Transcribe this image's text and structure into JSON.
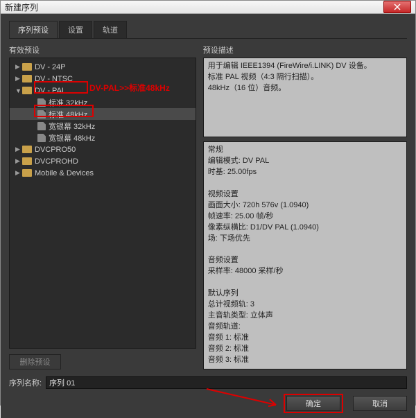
{
  "window": {
    "title": "新建序列"
  },
  "tabs": {
    "t0": "序列预设",
    "t1": "设置",
    "t2": "轨道"
  },
  "panels": {
    "presets_label": "有效预设",
    "desc_label": "预设描述"
  },
  "presets": {
    "dv24p": "DV - 24P",
    "dvntsc": "DV - NTSC",
    "dvpal": "DV - PAL",
    "std32": "标准 32kHz",
    "std48": "标准 48kHz",
    "ws32": "宽银幕 32kHz",
    "ws48": "宽银幕 48kHz",
    "dvcpro50": "DVCPRO50",
    "dvcprohd": "DVCPROHD",
    "mobile": "Mobile & Devices"
  },
  "annotation": {
    "text": "DV-PAL>>标准48kHz"
  },
  "desc_top": "用于编辑 IEEE1394 (FireWire/i.LINK) DV 设备。\n标准 PAL 视频（4:3 隔行扫描）。\n48kHz（16 位）音频。",
  "desc_bottom": "常规\n编辑模式: DV PAL\n时基: 25.00fps\n\n视频设置\n画面大小: 720h 576v (1.0940)\n帧速率: 25.00 帧/秒\n像素纵横比: D1/DV PAL (1.0940)\n场: 下场优先\n\n音频设置\n采样率: 48000 采样/秒\n\n默认序列\n总计视频轨: 3\n主音轨类型: 立体声\n音频轨道:\n音频 1: 标准\n音频 2: 标准\n音频 3: 标准",
  "delete_btn": "删除预设",
  "seq_name": {
    "label": "序列名称:",
    "value": "序列 01"
  },
  "buttons": {
    "ok": "确定",
    "cancel": "取消"
  }
}
